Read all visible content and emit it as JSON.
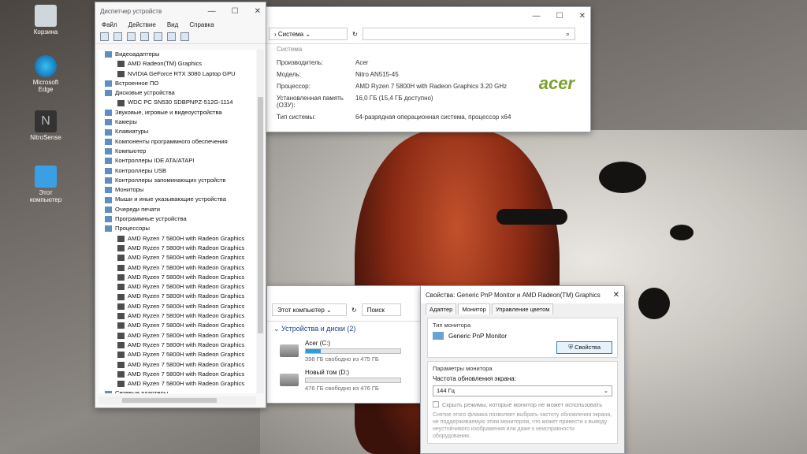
{
  "desktop": {
    "icons": [
      {
        "label": "Корзина",
        "icon": "recycle-bin-icon"
      },
      {
        "label": "Microsoft Edge",
        "icon": "edge-icon"
      },
      {
        "label": "NitroSense",
        "icon": "nitrosense-icon"
      },
      {
        "label": "Этот компьютер",
        "icon": "computer-icon"
      }
    ]
  },
  "device_manager": {
    "title": "Диспетчер устройств",
    "menu": [
      "Файл",
      "Действие",
      "Вид",
      "Справка"
    ],
    "tree": [
      "Видеоадаптеры",
      "AMD Radeon(TM) Graphics",
      "NVIDIA GeForce RTX 3080 Laptop GPU",
      "Встроенное ПО",
      "Дисковые устройства",
      "WDC PC SN530 SDBPNPZ-512G-1114",
      "Звуковые, игровые и видеоустройства",
      "Камеры",
      "Клавиатуры",
      "Компоненты программного обеспечения",
      "Компьютер",
      "Контроллеры IDE ATA/ATAPI",
      "Контроллеры USB",
      "Контроллеры запоминающих устройств",
      "Мониторы",
      "Мыши и иные указывающие устройства",
      "Очереди печати",
      "Программные устройства",
      "Процессоры",
      "AMD Ryzen 7 5800H with Radeon Graphics",
      "AMD Ryzen 7 5800H with Radeon Graphics",
      "AMD Ryzen 7 5800H with Radeon Graphics",
      "AMD Ryzen 7 5800H with Radeon Graphics",
      "AMD Ryzen 7 5800H with Radeon Graphics",
      "AMD Ryzen 7 5800H with Radeon Graphics",
      "AMD Ryzen 7 5800H with Radeon Graphics",
      "AMD Ryzen 7 5800H with Radeon Graphics",
      "AMD Ryzen 7 5800H with Radeon Graphics",
      "AMD Ryzen 7 5800H with Radeon Graphics",
      "AMD Ryzen 7 5800H with Radeon Graphics",
      "AMD Ryzen 7 5800H with Radeon Graphics",
      "AMD Ryzen 7 5800H with Radeon Graphics",
      "AMD Ryzen 7 5800H with Radeon Graphics",
      "AMD Ryzen 7 5800H with Radeon Graphics",
      "AMD Ryzen 7 5800H with Radeon Graphics",
      "Сетевые адаптеры"
    ]
  },
  "system_window": {
    "breadcrumb": "Система",
    "section": "Система",
    "specs": [
      {
        "label": "Производитель:",
        "value": "Acer"
      },
      {
        "label": "Модель:",
        "value": "Nitro AN515-45"
      },
      {
        "label": "Процессор:",
        "value": "AMD Ryzen 7 5800H with Radeon Graphics 3.20 GHz"
      },
      {
        "label": "Установленная память (ОЗУ):",
        "value": "16,0 ГБ (15,4 ГБ доступно)"
      },
      {
        "label": "Тип системы:",
        "value": "64-разрядная операционная система, процессор x64"
      }
    ],
    "logo": "acer"
  },
  "explorer": {
    "address": "Этот компьютер",
    "group": "Устройства и диски (2)",
    "drives": [
      {
        "name": "Acer (C:)",
        "free": "398 ГБ свободно из 475 ГБ",
        "used_fraction": 0.16
      },
      {
        "name": "Новый том (D:)",
        "free": "476 ГБ свободно из 476 ГБ",
        "used_fraction": 0.0
      }
    ]
  },
  "properties": {
    "title": "Свойства: Generic PnP Monitor и AMD Radeon(TM) Graphics",
    "tabs": [
      "Адаптер",
      "Монитор",
      "Управление цветом"
    ],
    "active_tab": "Монитор",
    "monitor_type_label": "Тип монитора",
    "monitor_name": "Generic PnP Monitor",
    "properties_button": "Свойства",
    "params_label": "Параметры монитора",
    "refresh_label": "Частота обновления экрана:",
    "refresh_value": "144 Гц",
    "hide_modes": "Скрыть режимы, которые монитор не может использовать",
    "hint": "Снятие этого флажка позволяет выбрать частоту обновления экрана, не поддерживаемую этим монитором, что может привести к выводу неустойчивого изображения или даже к неисправности оборудования."
  },
  "colors": {
    "accent": "#26a0da",
    "acer_green": "#7aa22b"
  }
}
